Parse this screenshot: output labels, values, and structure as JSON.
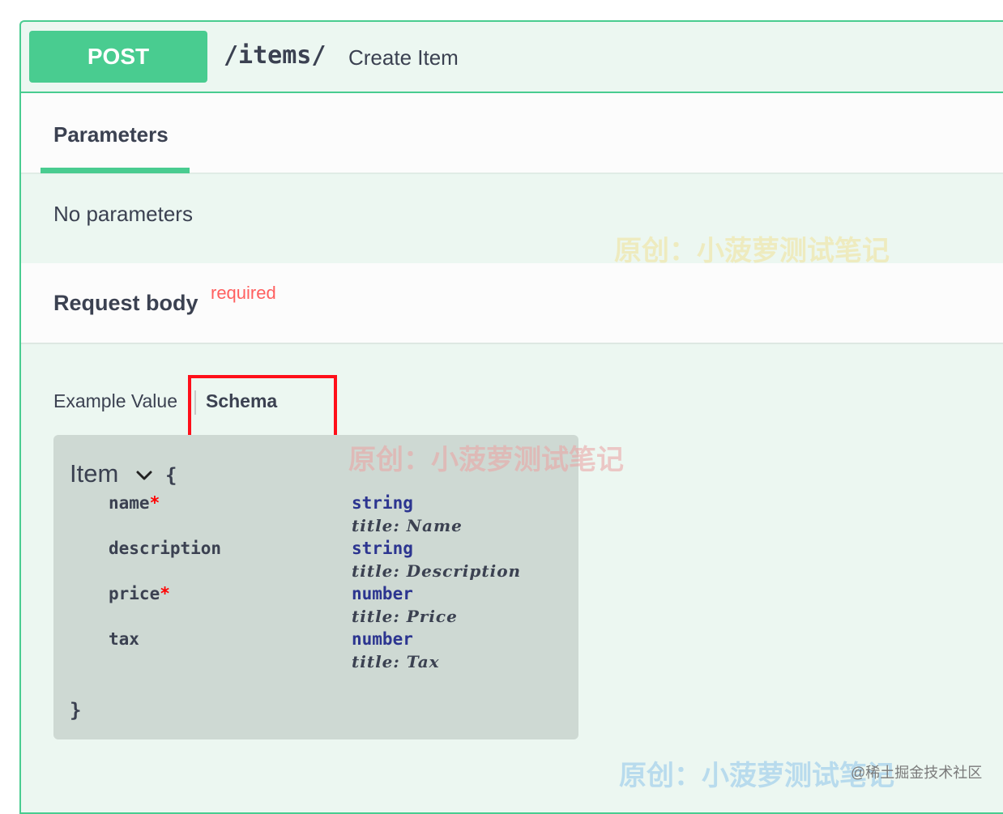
{
  "operation": {
    "method": "POST",
    "path": "/items/",
    "summary": "Create Item"
  },
  "tabs": {
    "parameters_label": "Parameters"
  },
  "parameters": {
    "empty_text": "No parameters"
  },
  "request_body": {
    "title": "Request body",
    "required_label": "required",
    "tab_example": "Example Value",
    "tab_schema": "Schema"
  },
  "schema": {
    "model_name": "Item",
    "open_brace": "{",
    "close_brace": "}",
    "properties": [
      {
        "name": "name",
        "required": "*",
        "type": "string",
        "title": "title: Name"
      },
      {
        "name": "description",
        "required": "",
        "type": "string",
        "title": "title: Description"
      },
      {
        "name": "price",
        "required": "*",
        "type": "number",
        "title": "title: Price"
      },
      {
        "name": "tax",
        "required": "",
        "type": "number",
        "title": "title: Tax"
      }
    ]
  },
  "watermarks": {
    "text": "原创：小菠萝测试笔记",
    "credit": "@稀土掘金技术社区"
  },
  "colors": {
    "post_green": "#49cc90",
    "required_red": "#ff6060",
    "highlight_red": "#ff0f1a",
    "type_blue": "#2c3590"
  }
}
